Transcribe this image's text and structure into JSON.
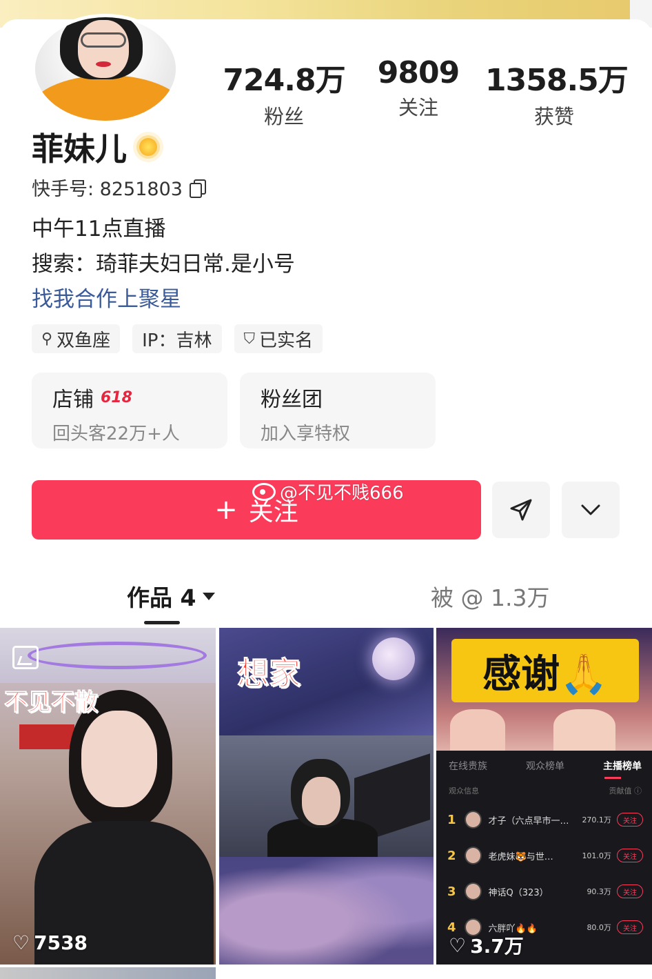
{
  "profile": {
    "name": "菲妹儿",
    "kuaishou_id_label": "快手号: 8251803",
    "bio": [
      "中午11点直播",
      "搜索：琦菲夫妇日常.是小号"
    ],
    "link": "找我合作上聚星"
  },
  "stats": [
    {
      "value": "724.8万",
      "label": "粉丝"
    },
    {
      "value": "9809",
      "label": "关注"
    },
    {
      "value": "1358.5万",
      "label": "获赞"
    }
  ],
  "tags": [
    {
      "icon": "search-icon",
      "glyph": "⚲",
      "label": "双鱼座"
    },
    {
      "icon": "",
      "glyph": "",
      "label": "IP：吉林"
    },
    {
      "icon": "shield-check-icon",
      "glyph": "⛉",
      "label": "已实名"
    }
  ],
  "cards": [
    {
      "title": "店铺",
      "badge": "618",
      "subtitle": "回头客22万+人"
    },
    {
      "title": "粉丝团",
      "badge": "",
      "subtitle": "加入享特权"
    }
  ],
  "actions": {
    "follow_plus": "+",
    "follow_label": "关注",
    "watermark": "@不见不贱666"
  },
  "tabs": {
    "works": "作品 4",
    "mentioned": "被 @ 1.3万"
  },
  "grid": [
    {
      "overlay_text": "不见不散",
      "likes": "7538",
      "has_gallery_icon": true
    },
    {
      "overlay_text": "想家",
      "likes": ""
    },
    {
      "overlay_text": "感谢🙏",
      "likes": "3.7万",
      "panel_tabs": [
        "在线贵族",
        "观众榜单",
        "主播榜单"
      ],
      "panel_header": [
        "观众信息",
        "贡献值 ⓘ"
      ],
      "ranking": [
        {
          "rank": "1",
          "name": "才子（六点早市一…",
          "score": "270.1万",
          "follow": "关注"
        },
        {
          "rank": "2",
          "name": "老虎妹🐯与世…",
          "score": "101.0万",
          "follow": "关注"
        },
        {
          "rank": "3",
          "name": "神话Q（323）",
          "score": "90.3万",
          "follow": "关注"
        },
        {
          "rank": "4",
          "name": "六胖吖🔥🔥",
          "score": "80.0万",
          "follow": "关注"
        }
      ]
    }
  ],
  "colors": {
    "accent": "#fb3b5a",
    "link": "#3a5a9a",
    "badge": "#e8253f",
    "thanks_bg": "#f6c613"
  }
}
